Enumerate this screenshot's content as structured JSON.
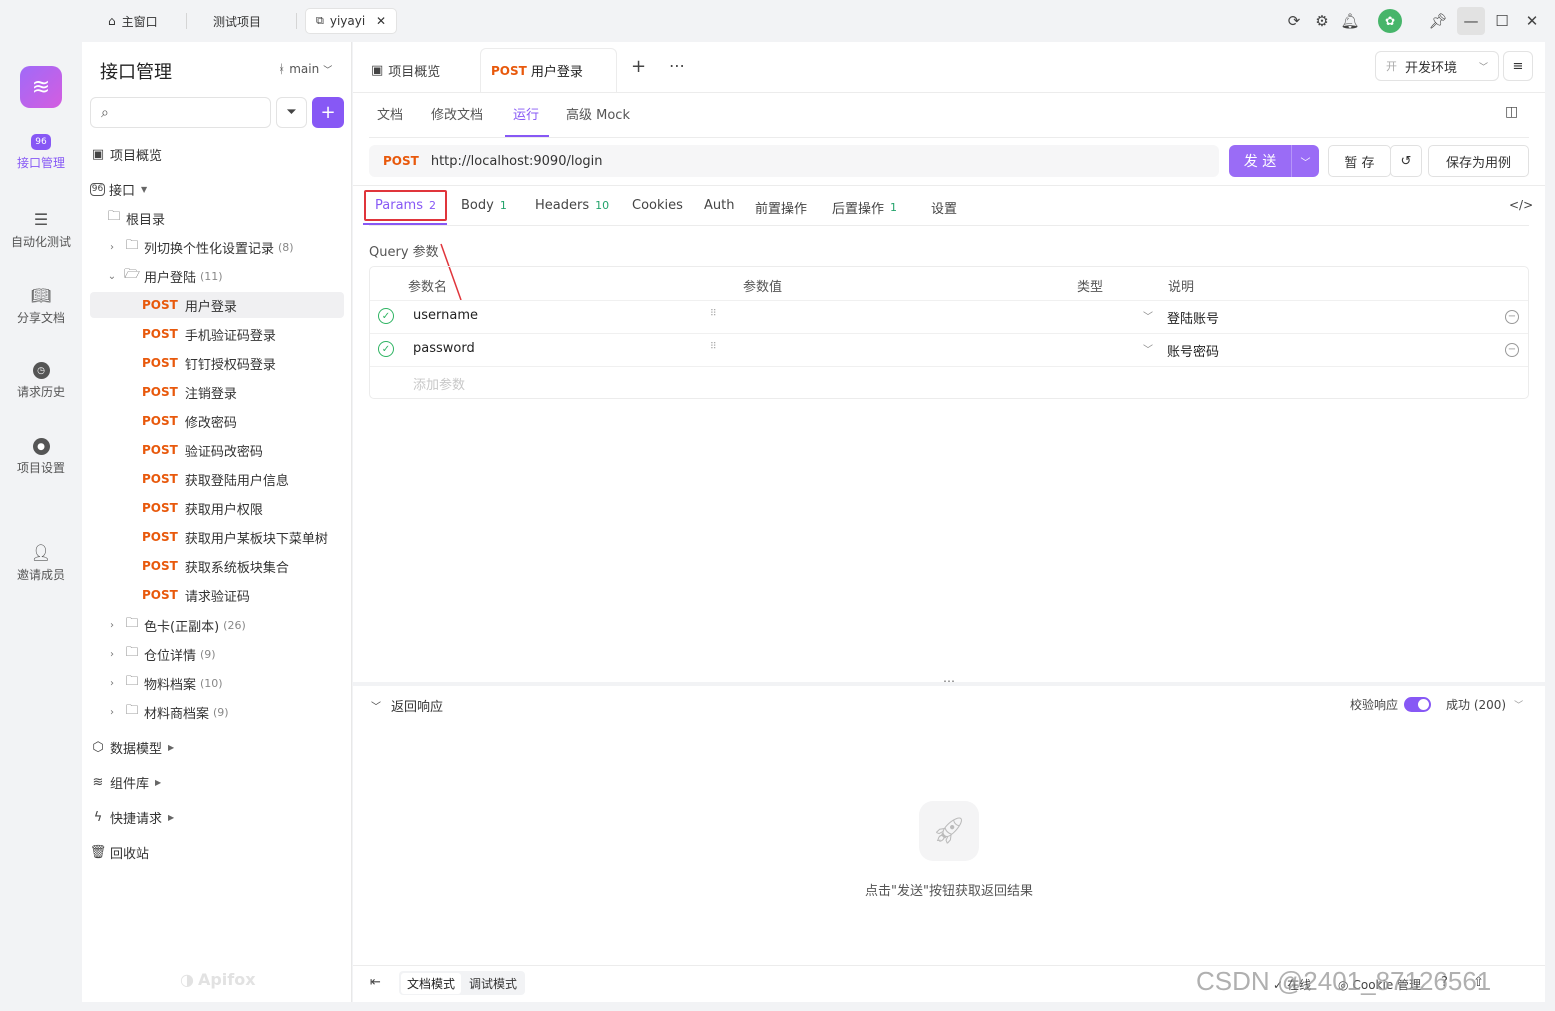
{
  "titlebar": {
    "tabs": [
      "主窗口",
      "测试项目",
      "yiyayi"
    ]
  },
  "rail": {
    "items": [
      "接口管理",
      "自动化测试",
      "分享文档",
      "请求历史",
      "项目设置",
      "邀请成员"
    ]
  },
  "sidebar": {
    "title": "接口管理",
    "branch": "main",
    "overview": "项目概览",
    "api_label": "接口",
    "root": "根目录",
    "folder_personal": {
      "name": "列切换个性化设置记录",
      "count": "(8)"
    },
    "folder_login": {
      "name": "用户登陆",
      "count": "(11)"
    },
    "method": "POST",
    "endpoints": [
      "用户登录",
      "手机验证码登录",
      "钉钉授权码登录",
      "注销登录",
      "修改密码",
      "验证码改密码",
      "获取登陆用户信息",
      "获取用户权限",
      "获取用户某板块下菜单树",
      "获取系统板块集合",
      "请求验证码"
    ],
    "folders": [
      {
        "name": "色卡(正副本)",
        "count": "(26)"
      },
      {
        "name": "仓位详情",
        "count": "(9)"
      },
      {
        "name": "物料档案",
        "count": "(10)"
      },
      {
        "name": "材料商档案",
        "count": "(9)"
      }
    ],
    "sections": [
      "数据模型",
      "组件库",
      "快捷请求",
      "回收站"
    ],
    "watermark": "Apifox"
  },
  "main": {
    "tabs": {
      "overview": "项目概览",
      "method": "POST",
      "active": "用户登录"
    },
    "env": {
      "badge": "开",
      "name": "开发环境"
    },
    "subtabs": [
      "文档",
      "修改文档",
      "运行",
      "高级 Mock"
    ],
    "request": {
      "method": "POST",
      "url": "http://localhost:9090/login"
    },
    "buttons": {
      "send": "发 送",
      "save_temp": "暂 存",
      "save_case": "保存为用例"
    },
    "param_tabs": [
      {
        "label": "Params",
        "count": "2"
      },
      {
        "label": "Body",
        "count": "1"
      },
      {
        "label": "Headers",
        "count": "10"
      },
      {
        "label": "Cookies",
        "count": ""
      },
      {
        "label": "Auth",
        "count": ""
      },
      {
        "label": "前置操作",
        "count": ""
      },
      {
        "label": "后置操作",
        "count": "1"
      },
      {
        "label": "设置",
        "count": ""
      }
    ],
    "query_title": "Query 参数",
    "columns": [
      "参数名",
      "参数值",
      "类型",
      "说明"
    ],
    "params": [
      {
        "name": "username",
        "desc": "登陆账号"
      },
      {
        "name": "password",
        "desc": "账号密码"
      }
    ],
    "add_param": "添加参数",
    "response": {
      "title": "返回响应",
      "validate": "校验响应",
      "status": "成功 (200)",
      "empty_hint": "点击\"发送\"按钮获取返回结果"
    },
    "footer": {
      "doc_mode": "文档模式",
      "debug_mode": "调试模式",
      "online": "在线",
      "cookie": "Cookie 管理",
      "watermark": "CSDN @2401_87126561"
    }
  },
  "colors": {
    "accent": "#8758f5",
    "post": "#e8590c",
    "ok": "#2fb463"
  }
}
